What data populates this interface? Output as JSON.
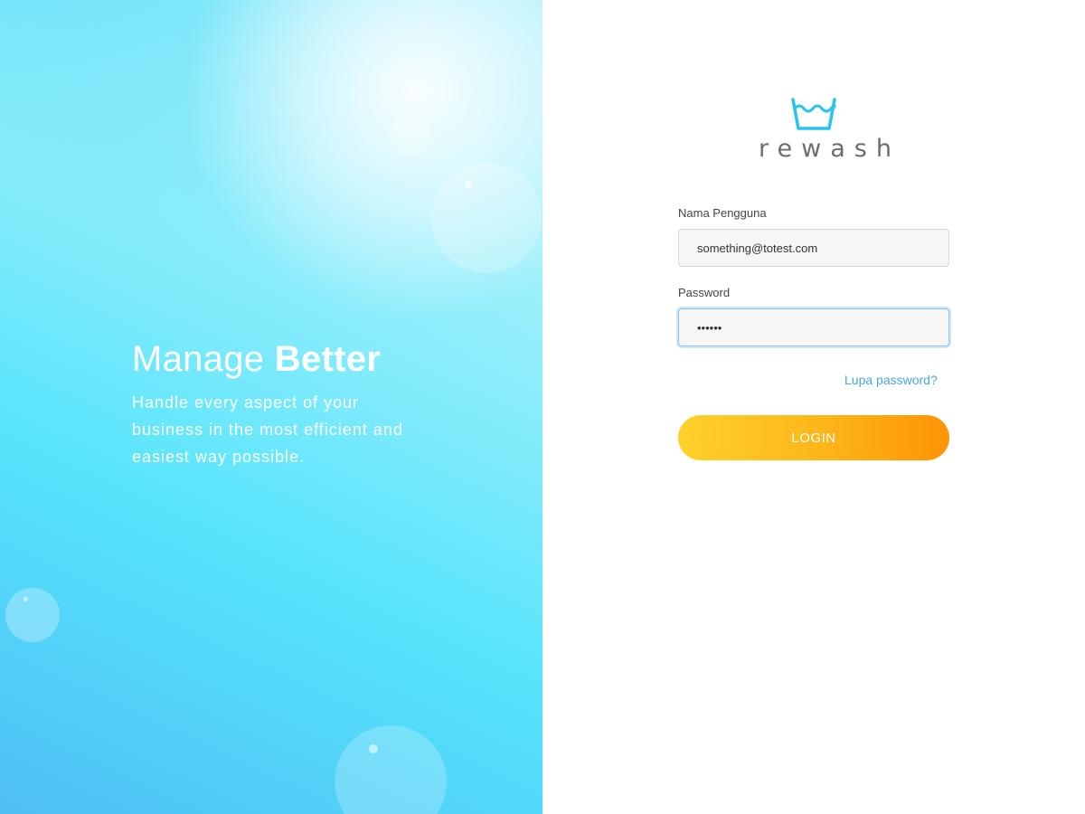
{
  "hero": {
    "title_regular": "Manage ",
    "title_bold": "Better",
    "subtitle": "Handle every aspect of your business in the most efficient and easiest way possible."
  },
  "logo": {
    "icon": "wash-basin-icon",
    "text": "rewash"
  },
  "form": {
    "username_label": "Nama Pengguna",
    "username_value": "something@totest.com",
    "password_label": "Password",
    "password_value": "123456",
    "forgot_label": "Lupa password?",
    "login_label": "LOGIN"
  },
  "colors": {
    "brand_cyan": "#29c4ee",
    "link_blue": "#49a6e8",
    "button_start": "#ffd12b",
    "button_end": "#ff9305"
  }
}
